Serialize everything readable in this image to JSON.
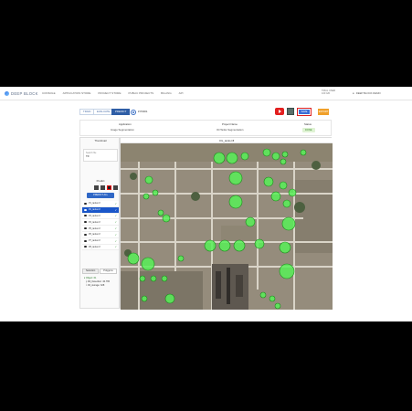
{
  "nav": {
    "logo": "DEEP BLOCK",
    "links": [
      "CONSOLE",
      "APPLICATION STORE",
      "PROJECT STORE",
      "PUBLIC PROJECTS",
      "BILLING",
      "API"
    ],
    "account_line1": "TRIAL USER",
    "account_line2": "100 GB",
    "user": "DEEP BLOCK DEMO"
  },
  "toolbar": {
    "tabs": [
      "TRAIN",
      "EVALUATE",
      "PREDICT"
    ],
    "active_tab": "PREDICT",
    "project_id": "# P0001",
    "save_label": "SAVE",
    "export_label": "EXPORT"
  },
  "info": {
    "headers": [
      "Application",
      "Project Name",
      "Status"
    ],
    "values": [
      "Image Segmentation",
      "Oil Tanks Segmentation",
      "DONE"
    ]
  },
  "left_panel": {
    "title": "Thumbnail",
    "search_label": "Search file",
    "search_value": "TIF",
    "predict_title": "Predict",
    "predict_button": "PREDICT ALL",
    "layers": [
      {
        "name": "P1_tanks.tif",
        "selected": false
      },
      {
        "name": "P2_tanks.tif",
        "selected": true
      },
      {
        "name": "P3_tanks.tif",
        "selected": false
      },
      {
        "name": "P4_tanks.tif",
        "selected": false
      },
      {
        "name": "P5_tanks.tif",
        "selected": false
      },
      {
        "name": "P6_tanks.tif",
        "selected": false
      },
      {
        "name": "P7_tanks.tif",
        "selected": false
      },
      {
        "name": "P8_tanks.tif",
        "selected": false
      }
    ],
    "tabs": [
      "Selection",
      "Polygons"
    ],
    "tree": {
      "root": "Object: 61",
      "child1": "Fill_Detection: 40.765",
      "child2": "Oil_storage: 328"
    }
  },
  "map": {
    "label": "OIL_tanks.tiff"
  },
  "colors": {
    "accent": "#2f5ea6",
    "detection": "#3cff3c",
    "export": "#f0a02a",
    "youtube": "#e21f1f"
  }
}
